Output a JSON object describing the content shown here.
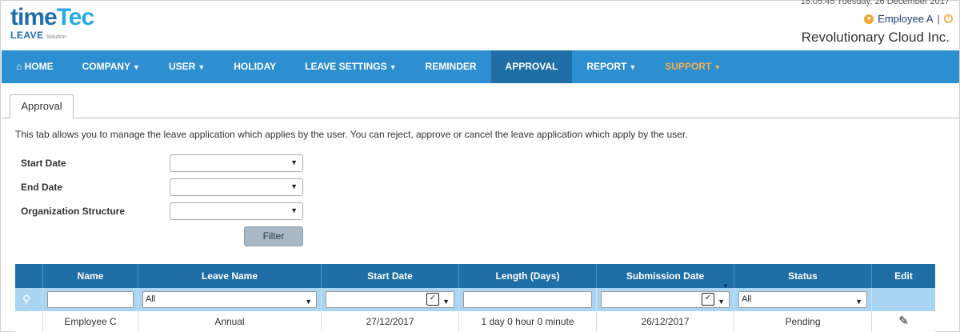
{
  "header": {
    "brand_time": "time",
    "brand_tec": "Tec",
    "sub_brand": "LEAVE",
    "sub_brand_small": "Solution",
    "datetime": "18:05:45 Tuesday, 26 December 2017",
    "user_name": "Employee A",
    "separator": "|",
    "power_icon": "⏻",
    "company_name": "Revolutionary Cloud Inc."
  },
  "nav": {
    "home": "HOME",
    "company": "COMPANY",
    "user": "USER",
    "holiday": "HOLIDAY",
    "leave_settings": "LEAVE SETTINGS",
    "reminder": "REMINDER",
    "approval": "APPROVAL",
    "report": "REPORT",
    "support": "SUPPORT",
    "active_color": "#1f6ea6",
    "support_color": "#f5b04b"
  },
  "tab": {
    "label": "Approval"
  },
  "description": "This tab allows you to manage the leave application which applies by the user. You can reject, approve or cancel the leave application which apply by the user.",
  "form": {
    "start_date_label": "Start Date",
    "end_date_label": "End Date",
    "org_label": "Organization Structure",
    "start_date_value": "",
    "end_date_value": "",
    "org_value": "",
    "filter_button": "Filter"
  },
  "table": {
    "columns": [
      "Name",
      "Leave Name",
      "Start Date",
      "Length (Days)",
      "Submission Date",
      "Status",
      "Edit"
    ],
    "filters": {
      "name": "",
      "leave_name": "All",
      "start_date": "",
      "length": "",
      "submission_date": "",
      "status": "All"
    },
    "rows": [
      {
        "name": "Employee C",
        "leave_name": "Annual",
        "start_date": "27/12/2017",
        "length": "1 day 0 hour 0 minute",
        "submission_date": "26/12/2017",
        "status": "Pending"
      }
    ]
  }
}
